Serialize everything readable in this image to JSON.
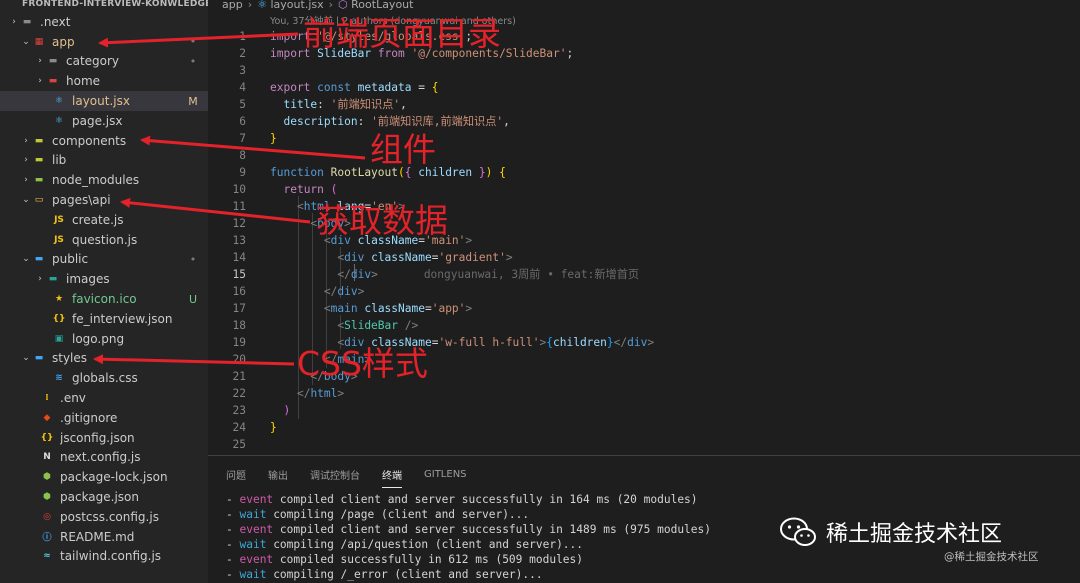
{
  "explorer": {
    "title": "FRONTEND-INTERVIEW-KONWLEDGE",
    "items": [
      {
        "label": ".next",
        "chevron": "›",
        "icon": "folder-icon",
        "color": "#8b8b8b",
        "badge": ""
      },
      {
        "label": "app",
        "chevron": "⌄",
        "icon": "folder-app-icon",
        "color": "#e0443e",
        "badge": "•"
      },
      {
        "label": "category",
        "chevron": "›",
        "icon": "folder-icon",
        "color": "#8b8b8b",
        "badge": "•"
      },
      {
        "label": "home",
        "chevron": "›",
        "icon": "folder-home-icon",
        "color": "#e0443e",
        "badge": ""
      },
      {
        "label": "layout.jsx",
        "chevron": "",
        "icon": "react-icon",
        "color": "#4fc3f7",
        "badge": "M"
      },
      {
        "label": "page.jsx",
        "chevron": "",
        "icon": "react-icon",
        "color": "#4fc3f7",
        "badge": ""
      },
      {
        "label": "components",
        "chevron": "›",
        "icon": "folder-components-icon",
        "color": "#c0ca33",
        "badge": ""
      },
      {
        "label": "lib",
        "chevron": "›",
        "icon": "folder-lib-icon",
        "color": "#c0ca33",
        "badge": ""
      },
      {
        "label": "node_modules",
        "chevron": "›",
        "icon": "folder-node-icon",
        "color": "#8bc34a",
        "badge": ""
      },
      {
        "label": "pages\\api",
        "chevron": "⌄",
        "icon": "folder-open-icon",
        "color": "#f9c74f",
        "badge": ""
      },
      {
        "label": "create.js",
        "chevron": "",
        "icon": "js-file-icon",
        "color": "#f1c40f",
        "badge": ""
      },
      {
        "label": "question.js",
        "chevron": "",
        "icon": "js-file-icon",
        "color": "#f1c40f",
        "badge": ""
      },
      {
        "label": "public",
        "chevron": "⌄",
        "icon": "folder-public-icon",
        "color": "#42a5f5",
        "badge": "•"
      },
      {
        "label": "images",
        "chevron": "›",
        "icon": "folder-images-icon",
        "color": "#26a69a",
        "badge": ""
      },
      {
        "label": "favicon.ico",
        "chevron": "",
        "icon": "star-icon",
        "color": "#f4c20d",
        "badge": "U"
      },
      {
        "label": "fe_interview.json",
        "chevron": "",
        "icon": "json-file-icon",
        "color": "#f4c20d",
        "badge": ""
      },
      {
        "label": "logo.png",
        "chevron": "",
        "icon": "image-file-icon",
        "color": "#26a69a",
        "badge": ""
      },
      {
        "label": "styles",
        "chevron": "⌄",
        "icon": "folder-styles-icon",
        "color": "#42a5f5",
        "badge": ""
      },
      {
        "label": "globals.css",
        "chevron": "",
        "icon": "css-file-icon",
        "color": "#42a5f5",
        "badge": ""
      },
      {
        "label": ".env",
        "chevron": "",
        "icon": "env-file-icon",
        "color": "#f4c20d",
        "badge": ""
      },
      {
        "label": ".gitignore",
        "chevron": "",
        "icon": "git-icon",
        "color": "#e64a19",
        "badge": ""
      },
      {
        "label": "jsconfig.json",
        "chevron": "",
        "icon": "json-file-icon",
        "color": "#f4c20d",
        "badge": ""
      },
      {
        "label": "next.config.js",
        "chevron": "",
        "icon": "next-icon",
        "color": "#dddddd",
        "badge": ""
      },
      {
        "label": "package-lock.json",
        "chevron": "",
        "icon": "npm-icon",
        "color": "#8bc34a",
        "badge": ""
      },
      {
        "label": "package.json",
        "chevron": "",
        "icon": "npm-icon",
        "color": "#8bc34a",
        "badge": ""
      },
      {
        "label": "postcss.config.js",
        "chevron": "",
        "icon": "postcss-icon",
        "color": "#e0443e",
        "badge": ""
      },
      {
        "label": "README.md",
        "chevron": "",
        "icon": "info-icon",
        "color": "#42a5f5",
        "badge": ""
      },
      {
        "label": "tailwind.config.js",
        "chevron": "",
        "icon": "tailwind-icon",
        "color": "#4dd0e1",
        "badge": ""
      }
    ]
  },
  "breadcrumb": {
    "segments": [
      "app",
      "layout.jsx",
      "RootLayout"
    ]
  },
  "blame_header": "You, 37分钟前 | 2 authors (dongyuanwai and others)",
  "inline_blame": "dongyuanwai, 3周前 • feat:新增首页",
  "active_line": "15",
  "code_lines": [
    {
      "n": "1"
    },
    {
      "n": "2"
    },
    {
      "n": "3"
    },
    {
      "n": "4"
    },
    {
      "n": "5"
    },
    {
      "n": "6"
    },
    {
      "n": "7"
    },
    {
      "n": "8"
    },
    {
      "n": "9"
    },
    {
      "n": "10"
    },
    {
      "n": "11"
    },
    {
      "n": "12"
    },
    {
      "n": "13"
    },
    {
      "n": "14"
    },
    {
      "n": "15"
    },
    {
      "n": "16"
    },
    {
      "n": "17"
    },
    {
      "n": "18"
    },
    {
      "n": "19"
    },
    {
      "n": "20"
    },
    {
      "n": "21"
    },
    {
      "n": "22"
    },
    {
      "n": "23"
    },
    {
      "n": "24"
    },
    {
      "n": "25"
    }
  ],
  "code": {
    "kw_import": "import",
    "kw_from": "from",
    "path_globals": "'@/styles/globals.css'",
    "id_slidebar": "SlideBar",
    "path_slidebar": "'@/components/SlideBar'",
    "kw_export": "export",
    "kw_const": "const",
    "id_metadata": "metadata",
    "prop_title": "title",
    "val_title": "'前端知识点'",
    "prop_description": "description",
    "val_description": "'前端知识库,前端知识点'",
    "kw_function": "function",
    "id_rootlayout": "RootLayout",
    "id_children": "children",
    "kw_return": "return",
    "tag_html": "html",
    "attr_lang": "lang",
    "val_lang": "'en'",
    "tag_body": "body",
    "tag_div": "div",
    "attr_classname": "className",
    "val_main": "'main'",
    "val_gradient": "'gradient'",
    "tag_main": "main",
    "val_app": "'app'",
    "tag_slidebar": "SlideBar",
    "val_wfull": "'w-full h-full'"
  },
  "panel": {
    "tabs": [
      "问题",
      "输出",
      "调试控制台",
      "终端",
      "GITLENS"
    ],
    "active_tab": "终端",
    "lines": [
      {
        "kind": "event",
        "text": "compiled client and server successfully in 164 ms (20 modules)"
      },
      {
        "kind": "wait",
        "text": "compiling /page (client and server)..."
      },
      {
        "kind": "event",
        "text": "compiled client and server successfully in 1489 ms (975 modules)"
      },
      {
        "kind": "wait",
        "text": "compiling /api/question (client and server)..."
      },
      {
        "kind": "event",
        "text": "compiled successfully in 612 ms (509 modules)"
      },
      {
        "kind": "wait",
        "text": "compiling /_error (client and server)..."
      }
    ]
  },
  "annotations": {
    "pages_dir": "前端页面目录",
    "components": "组件",
    "fetch_data": "获取数据",
    "css_styles": "CSS样式"
  },
  "watermark": {
    "title": "稀土掘金技术社区",
    "subtitle": "@稀土掘金技术社区"
  },
  "colors": {
    "annotation_red": "#e4222a",
    "event": "#cd5ba8",
    "wait": "#3ea6d6"
  }
}
